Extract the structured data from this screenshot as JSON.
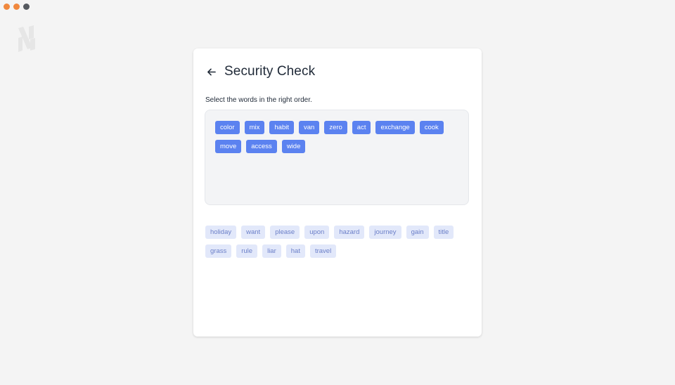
{
  "window": {
    "dot_colors": [
      "#f0883e",
      "#f0883e",
      "#55595f"
    ]
  },
  "card": {
    "title": "Security Check",
    "back_icon": "arrow-left-icon",
    "instructions": "Select the words in the right order."
  },
  "selected_words": [
    "color",
    "mix",
    "habit",
    "van",
    "zero",
    "act",
    "exchange",
    "cook",
    "move",
    "access",
    "wide"
  ],
  "available_words": [
    "holiday",
    "want",
    "please",
    "upon",
    "hazard",
    "journey",
    "gain",
    "title",
    "grass",
    "rule",
    "liar",
    "hat",
    "travel"
  ],
  "colors": {
    "selected_chip": "#5b82f0",
    "available_chip": "#e2e8fa",
    "available_text": "#6b7fc8"
  }
}
